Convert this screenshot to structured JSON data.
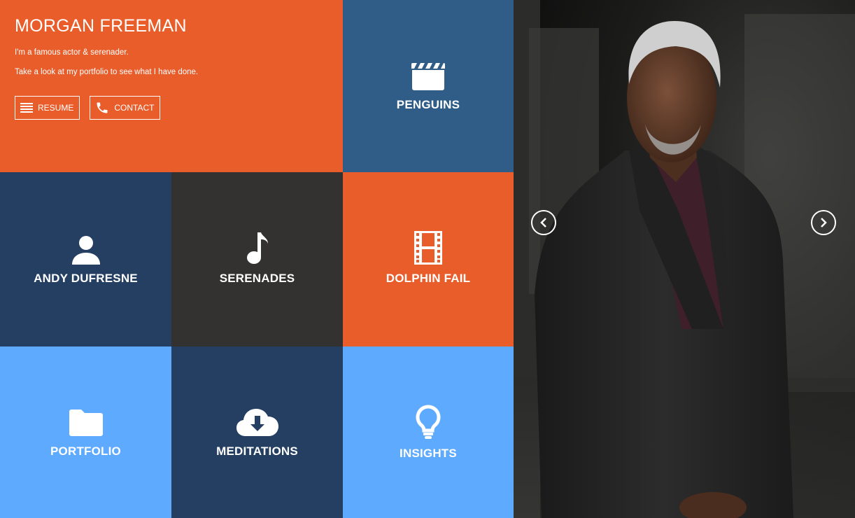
{
  "profile": {
    "name": "MORGAN FREEMAN",
    "tagline": "I'm a famous actor & serenader.",
    "intro": "Take a look at my portfolio to see what I have done."
  },
  "buttons": {
    "resume": "RESUME",
    "contact": "CONTACT"
  },
  "tiles": {
    "penguins": "PENGUINS",
    "andy": "ANDY DUFRESNE",
    "serenades": "SERENADES",
    "dolphin": "DOLPHIN FAIL",
    "portfolio": "PORTFOLIO",
    "meditations": "MEDITATIONS",
    "insights": "INSIGHTS"
  },
  "icons": {
    "penguins": "film-clapper-icon",
    "andy": "person-icon",
    "serenades": "music-note-icon",
    "dolphin": "film-strip-icon",
    "portfolio": "folder-icon",
    "meditations": "cloud-download-icon",
    "insights": "lightbulb-icon"
  },
  "colors": {
    "orange": "#e95d2b",
    "steel_blue": "#2f5d87",
    "navy": "#243f61",
    "charcoal": "#343231",
    "sky_blue": "#5eaaff"
  }
}
